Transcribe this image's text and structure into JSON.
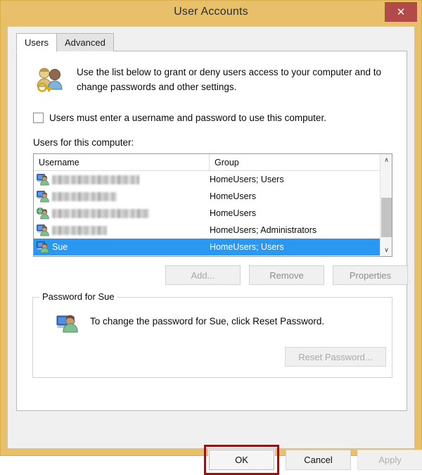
{
  "window": {
    "title": "User Accounts",
    "frame_color": "#e8c06a",
    "close_label": "✕",
    "close_icon": "close-icon",
    "close_bg": "#b24a49"
  },
  "tabs": [
    {
      "label": "Users",
      "active": true
    },
    {
      "label": "Advanced",
      "active": false
    }
  ],
  "info": {
    "icon": "users-key-icon",
    "text": "Use the list below to grant or deny users access to your computer and to change passwords and other settings."
  },
  "require_password": {
    "label": "Users must enter a username and password to use this computer.",
    "checked": false
  },
  "list": {
    "label": "Users for this computer:",
    "columns": [
      "Username",
      "Group"
    ],
    "selection_color": "#2a98f0",
    "rows": [
      {
        "username": "",
        "redacted": true,
        "redacted_width": 124,
        "group": "HomeUsers; Users",
        "icon": "user-account-icon",
        "selected": false
      },
      {
        "username": "",
        "redacted": true,
        "redacted_width": 92,
        "group": "HomeUsers",
        "icon": "user-account-icon",
        "selected": false
      },
      {
        "username": "",
        "redacted": true,
        "redacted_width": 138,
        "group": "HomeUsers",
        "icon": "microsoft-account-icon",
        "selected": false
      },
      {
        "username": "",
        "redacted": true,
        "redacted_width": 78,
        "group": "HomeUsers; Administrators",
        "icon": "user-account-icon",
        "selected": false
      },
      {
        "username": "Sue",
        "redacted": false,
        "redacted_width": 0,
        "group": "HomeUsers; Users",
        "icon": "user-account-icon",
        "selected": true
      }
    ],
    "scrollbar": {
      "up_glyph": "∧",
      "down_glyph": "∨"
    }
  },
  "actions": {
    "add": "Add...",
    "remove": "Remove",
    "properties": "Properties"
  },
  "password_group": {
    "title": "Password for Sue",
    "icon": "single-user-icon",
    "info": "To change the password for Sue, click Reset Password.",
    "reset_button": "Reset Password...",
    "reset_enabled": false
  },
  "footer": {
    "ok": "OK",
    "cancel": "Cancel",
    "apply": "Apply",
    "apply_enabled": false,
    "ok_highlight_color": "#8f1616"
  }
}
